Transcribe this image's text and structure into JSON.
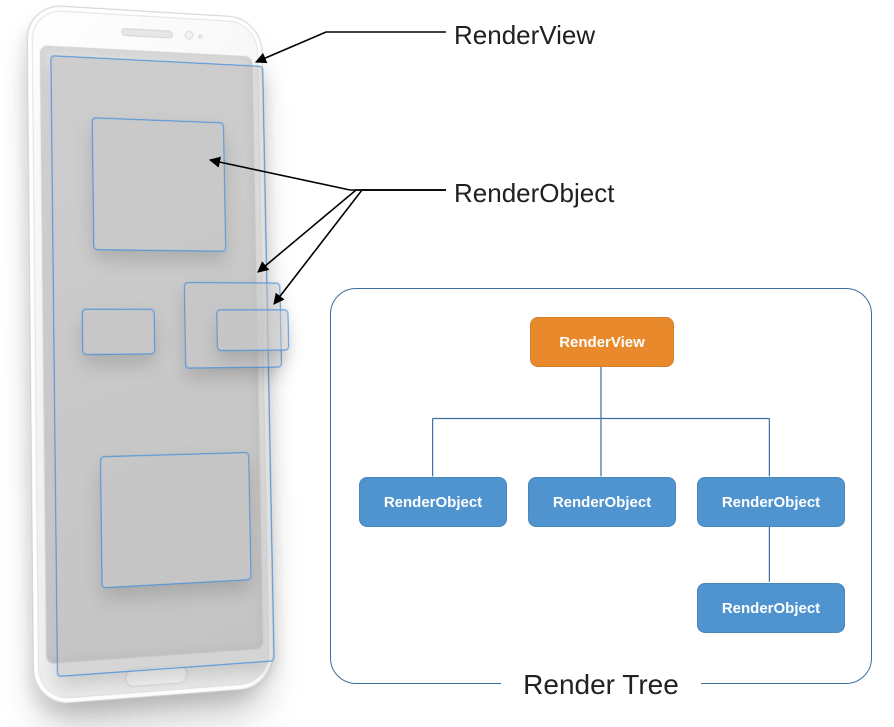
{
  "labels": {
    "render_view": "RenderView",
    "render_object": "RenderObject"
  },
  "tree": {
    "title": "Render Tree",
    "root": "RenderView",
    "children": [
      "RenderObject",
      "RenderObject",
      "RenderObject"
    ],
    "grandchild": "RenderObject"
  },
  "colors": {
    "outline_blue": "#4a90d9",
    "node_orange": "#e8892b",
    "node_blue": "#4f94cf",
    "panel_border": "#3b6fa0"
  }
}
